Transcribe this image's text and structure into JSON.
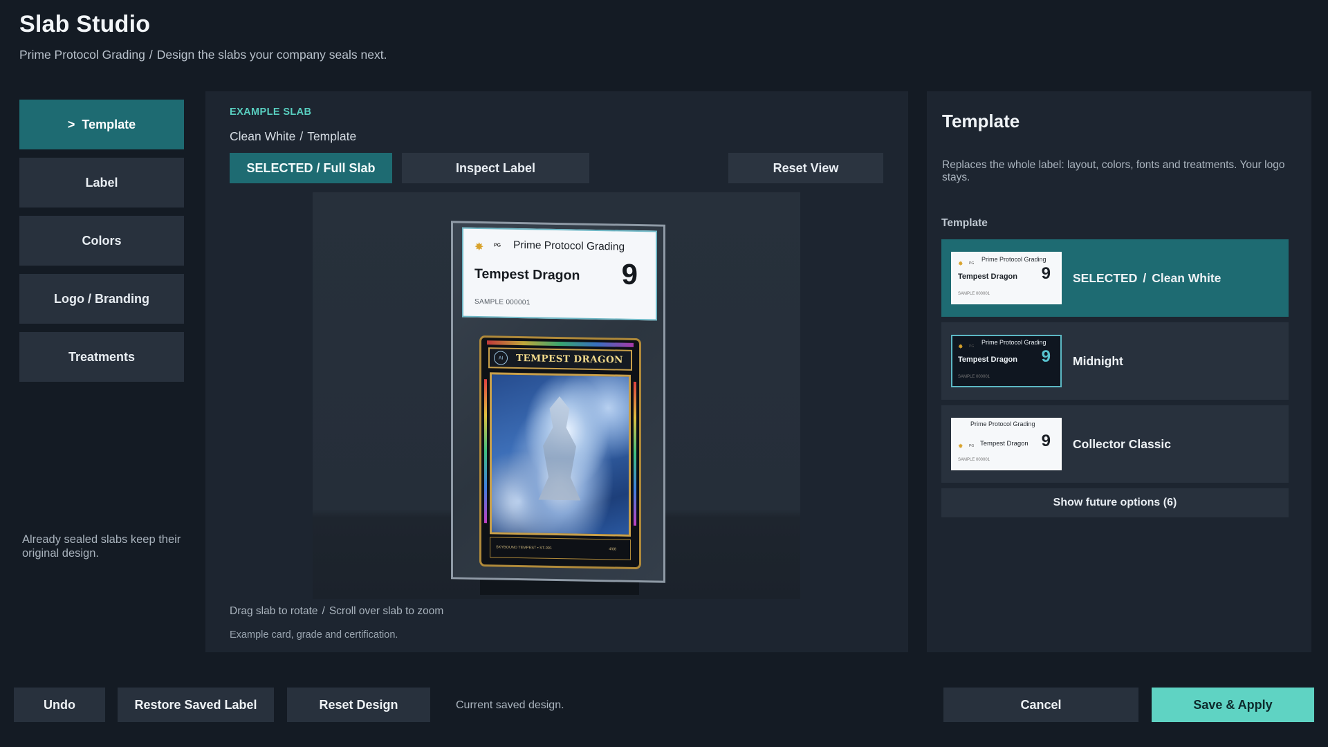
{
  "header": {
    "title": "Slab Studio",
    "company": "Prime Protocol Grading",
    "separator": "/",
    "tagline": "Design the slabs your company seals next."
  },
  "nav": {
    "active_prefix": ">",
    "items": [
      {
        "label": "Template",
        "active": true
      },
      {
        "label": "Label",
        "active": false
      },
      {
        "label": "Colors",
        "active": false
      },
      {
        "label": "Logo / Branding",
        "active": false
      },
      {
        "label": "Treatments",
        "active": false
      }
    ],
    "note": "Already sealed slabs keep their original design."
  },
  "center": {
    "eyebrow": "EXAMPLE SLAB",
    "crumb_template": "Clean White",
    "crumb_section": "Template",
    "buttons": {
      "full_slab": "SELECTED / Full Slab",
      "inspect": "Inspect Label",
      "reset_view": "Reset View"
    },
    "hint_rotate": "Drag slab to rotate",
    "hint_zoom": "Scroll over slab to zoom",
    "hint_example": "Example card, grade and certification."
  },
  "slab": {
    "logo_mini": "PG",
    "company": "Prime Protocol Grading",
    "card_name": "Tempest Dragon",
    "grade": "9",
    "cert": "SAMPLE 000001",
    "card_title": "TEMPEST DRAGON",
    "card_badge": "AI",
    "card_footer_left": "SKYBOUND TEMPEST  •  ST-001",
    "card_footer_right": "4/08"
  },
  "right": {
    "title": "Template",
    "description": "Replaces the whole label: layout, colors, fonts and treatments. Your logo stays.",
    "section": "Template",
    "options": [
      {
        "prefix": "SELECTED",
        "name": "Clean White",
        "selected": true
      },
      {
        "prefix": "",
        "name": "Midnight",
        "selected": false
      },
      {
        "prefix": "",
        "name": "Collector Classic",
        "selected": false
      }
    ],
    "thumb": {
      "company": "Prime Protocol Grading",
      "name": "Tempest Dragon",
      "grade": "9",
      "cert": "SAMPLE 000001",
      "mini": "PG"
    },
    "future": "Show future options (6)"
  },
  "footer": {
    "undo": "Undo",
    "restore": "Restore Saved Label",
    "reset": "Reset Design",
    "status": "Current saved design.",
    "cancel": "Cancel",
    "save": "Save & Apply"
  },
  "colors": {
    "accent": "#1e6b72",
    "primary": "#5fd3c3",
    "eyebrow": "#59cfc0",
    "background": "#141b24",
    "panel": "#1d2530"
  }
}
